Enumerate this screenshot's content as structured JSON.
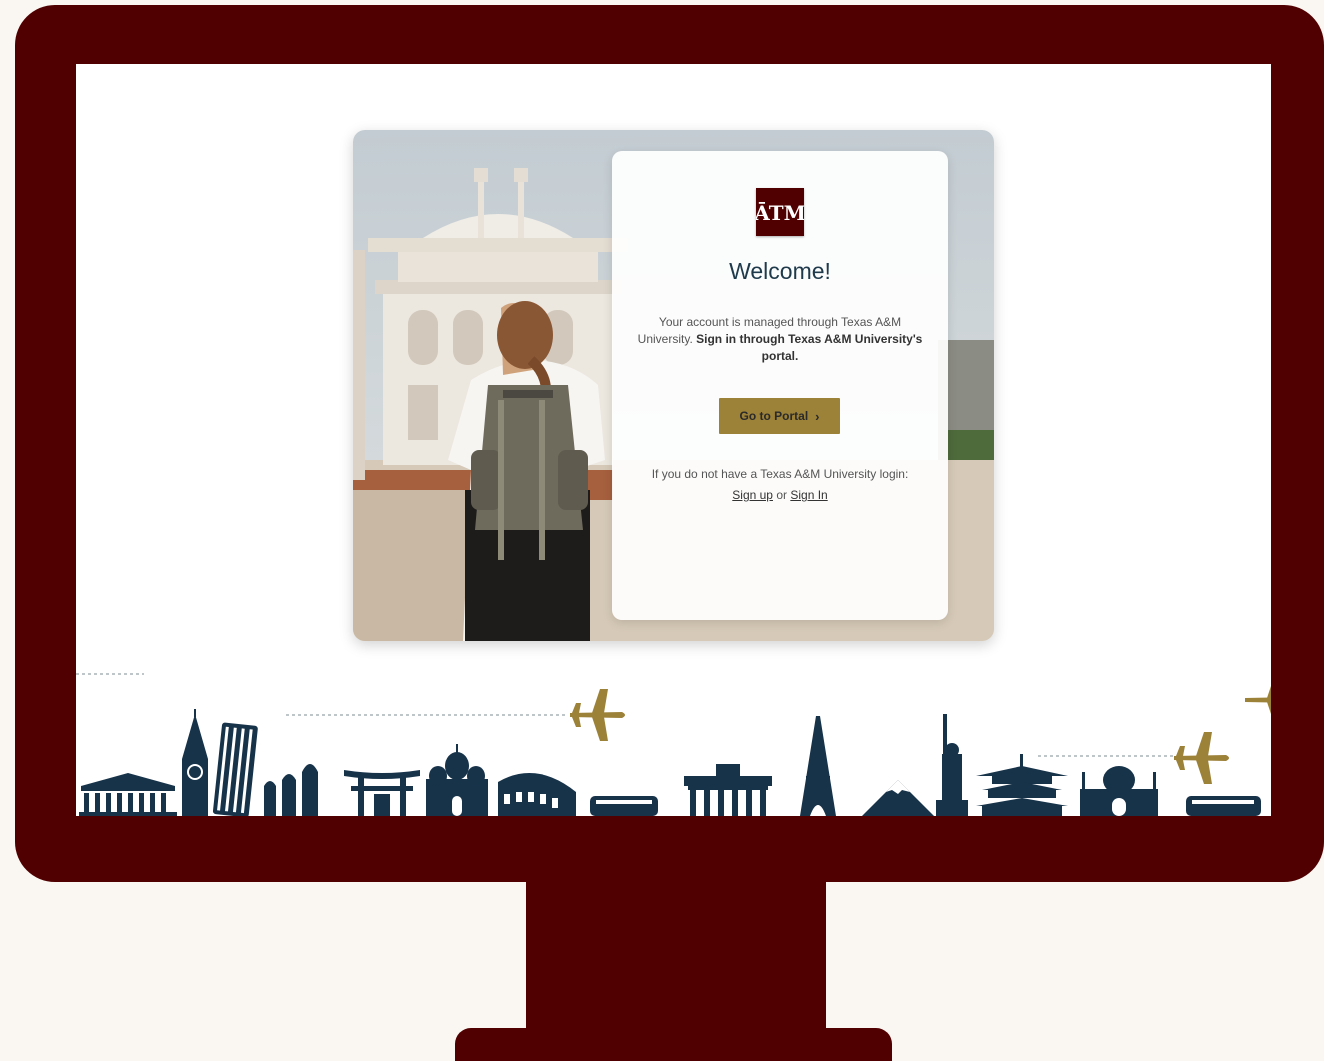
{
  "login": {
    "logo_text": "ĀTM",
    "heading": "Welcome!",
    "message_prefix": "Your account is managed through Texas A&M University.",
    "message_bold": "Sign in through Texas A&M University's portal.",
    "portal_button": "Go to Portal",
    "chevron_glyph": "›",
    "no_login_text": "If you do not have a Texas A&M University login:",
    "sign_up": "Sign up",
    "or_text": "or",
    "sign_in": "Sign In"
  },
  "colors": {
    "maroon": "#500000",
    "gold": "#9c8138",
    "navy": "#1e3a4b",
    "page_background": "#faf6f1"
  },
  "decor": {
    "landmarks": [
      "parthenon",
      "big-ben",
      "leaning-tower-of-pisa",
      "moai-statues",
      "torii-gate",
      "st-basils-cathedral",
      "colosseum",
      "bus",
      "brandenburg-gate",
      "eiffel-tower",
      "mount-fuji",
      "statue-of-liberty",
      "pagoda",
      "taj-mahal",
      "bus"
    ],
    "airplane_icon": "airplane-icon"
  }
}
